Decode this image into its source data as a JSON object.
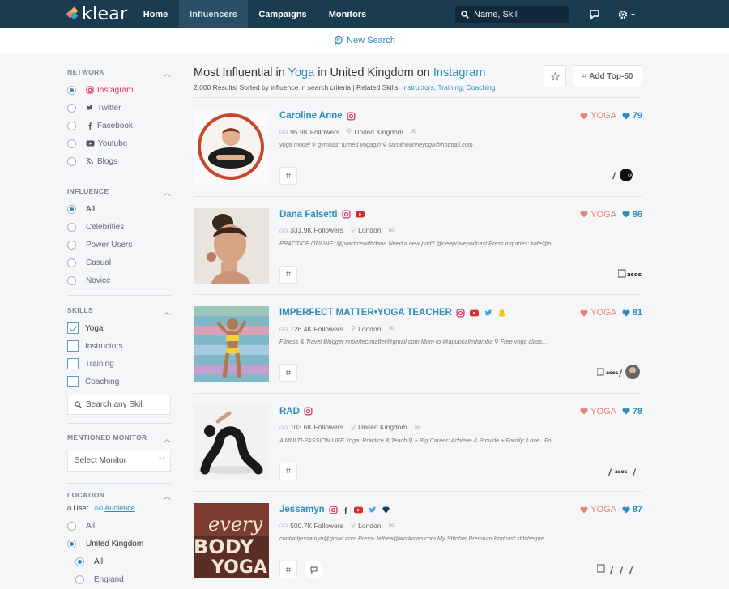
{
  "app": {
    "logo": "klear",
    "colors": {
      "topbar": "#1b3b50",
      "accent": "#2f8bbb",
      "topic": "#e8837a"
    }
  },
  "nav": {
    "items": [
      {
        "label": "Influencers"
      },
      {
        "label": "Campaigns"
      },
      {
        "label": "Monitors"
      }
    ],
    "active": "Influencers"
  },
  "search": {
    "placeholder": "Name, Skill"
  },
  "subbar": {
    "new_search": "New Search"
  },
  "sidebar": {
    "network": {
      "title": "NETWORK",
      "options": [
        "Instagram",
        "Twitter",
        "Facebook",
        "Youtube",
        "Blogs"
      ],
      "selected": "Instagram"
    },
    "influence": {
      "title": "INFLUENCE",
      "options": [
        "All",
        "Celebrities",
        "Power Users",
        "Casual",
        "Novice"
      ],
      "selected": "All"
    },
    "skills": {
      "title": "SKILLS",
      "options": [
        "Yoga",
        "Instructors",
        "Training",
        "Coaching"
      ],
      "checked": [
        "Yoga"
      ],
      "search_placeholder": "Search any Skill"
    },
    "monitor": {
      "title": "MENTIONED MONITOR",
      "select": "Select Monitor"
    },
    "location": {
      "title": "LOCATION",
      "user": "User",
      "audience": "Audience",
      "options": [
        "All",
        "United Kingdom"
      ],
      "selected": "United Kingdom",
      "sub_options": [
        "All",
        "England"
      ],
      "sub_selected": "All"
    }
  },
  "results": {
    "title_prefix": "Most Influential in",
    "skill": "Yoga",
    "in_word": "in",
    "location": "United Kingdom",
    "on_word": "on",
    "network": "Instagram",
    "count_text": "2,000 Results| Sorted by influence in search criteria  |  Related Skills:",
    "related": [
      "Instructors,",
      "Training,",
      "Coaching"
    ],
    "add_top": "Add Top-50",
    "items": [
      {
        "name": "Caroline Anne",
        "followers": "95.9K Followers",
        "location": "United Kingdom",
        "bio": "yoga model  ⚲  gymnast turned yogagirl  ⚲  carolineanneyoga@hotmail.com",
        "topic": "YOGA",
        "score": "79",
        "networks": [
          "instagram"
        ]
      },
      {
        "name": "Dana Falsetti",
        "followers": "331.9K Followers",
        "location": "London",
        "bio": "PRACTICE ONLINE: @practicewithdana Need a new pod? @deepdivepodcast Press inquiries: kate@p...",
        "topic": "YOGA",
        "score": "86",
        "networks": [
          "instagram",
          "youtube"
        ]
      },
      {
        "name": "IMPERFECT MATTER•YOGA TEACHER",
        "followers": "126.4K Followers",
        "location": "London",
        "bio": "Fitness & Travel Blogger imperfectmatter@gmail.com Mum to @apupcalledsimba  ⚲  Free yoga class...",
        "topic": "YOGA",
        "score": "81",
        "networks": [
          "instagram",
          "youtube",
          "twitter",
          "snapchat"
        ]
      },
      {
        "name": "RAD",
        "followers": "103.6K Followers",
        "location": "United Kingdom",
        "bio": "A MULTI-PASSION LIFE Yoga: Practice & Teach ⚲  + Big Career: Achieve & Provide + Family: Love . Fo...",
        "topic": "YOGA",
        "score": "78",
        "networks": [
          "instagram"
        ]
      },
      {
        "name": "Jessamyn",
        "followers": "500.7K Followers",
        "location": "London",
        "bio": "contactjessamyn@gmail.com Press- lathea@workman.com My Stitcher Premium Podcast stitcherpre...",
        "topic": "YOGA",
        "score": "87",
        "networks": [
          "instagram",
          "facebook",
          "youtube",
          "twitter",
          "heart"
        ]
      }
    ]
  }
}
